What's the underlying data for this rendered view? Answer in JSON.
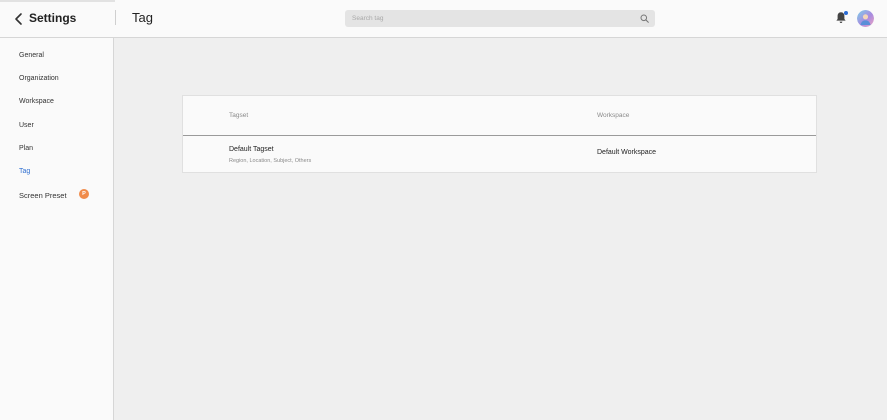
{
  "header": {
    "settings_title": "Settings",
    "page_title": "Tag",
    "search_placeholder": "Search tag"
  },
  "sidebar": {
    "items": [
      {
        "label": "General"
      },
      {
        "label": "Organization"
      },
      {
        "label": "Workspace"
      },
      {
        "label": "User"
      },
      {
        "label": "Plan"
      },
      {
        "label": "Tag",
        "active": true
      },
      {
        "label": "Screen Preset",
        "badge": "P"
      }
    ]
  },
  "table": {
    "columns": [
      "Tagset",
      "Workspace"
    ],
    "rows": [
      {
        "name": "Default Tagset",
        "tags": "Region, Location, Subject, Others",
        "workspace": "Default Workspace"
      }
    ]
  },
  "colors": {
    "accent": "#2f6fd1",
    "badge": "#f08b4a",
    "notification_dot": "#2b6cd6"
  },
  "icons": [
    "back-chevron-icon",
    "search-icon",
    "bell-icon",
    "avatar"
  ]
}
